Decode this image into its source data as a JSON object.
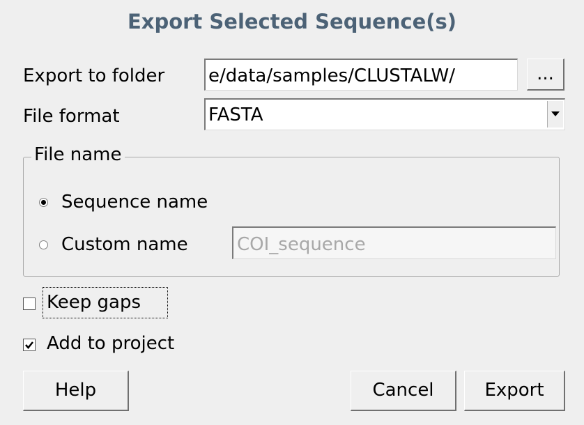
{
  "dialog": {
    "title": "Export Selected Sequence(s)",
    "export_to_folder_label": "Export to folder",
    "folder_value": "e/data/samples/CLUSTALW/",
    "browse_label": "...",
    "file_format_label": "File format",
    "file_format_value": "FASTA",
    "file_name_group_label": "File name",
    "sequence_name_label": "Sequence name",
    "sequence_name_selected": true,
    "custom_name_label": "Custom name",
    "custom_name_value": "COI_sequence",
    "custom_name_selected": false,
    "keep_gaps_label": "Keep gaps",
    "keep_gaps_checked": false,
    "add_to_project_label": "Add to project",
    "add_to_project_checked": true,
    "help_label": "Help",
    "cancel_label": "Cancel",
    "export_label": "Export"
  },
  "icons": {
    "combo_arrow": "chevron-down-icon",
    "radio_selected": "radio-checked-icon",
    "checkbox_checked": "checkmark-icon"
  },
  "colors": {
    "title": "#4c6276",
    "background": "#efefef",
    "disabled_text": "#a8a8a8"
  }
}
